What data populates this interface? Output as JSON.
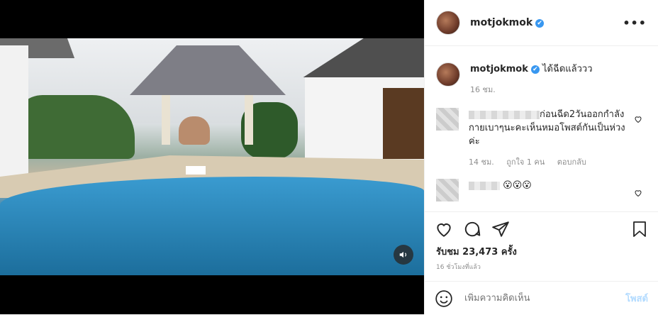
{
  "header": {
    "username": "motjokmok",
    "verified_icon": "✔",
    "more_icon": "more-horizontal-icon"
  },
  "caption": {
    "username": "motjokmok",
    "text": "ได้ฉีดแล้ววว",
    "time": "16 ชม."
  },
  "comments": [
    {
      "text": "ก่อนฉีด2วันออกกำลังกายเบาๆนะคะเห็นหมอโพสต์กันเป็นห่วงค่ะ",
      "time": "14 ชม.",
      "likes": "ถูกใจ 1 คน",
      "reply": "ตอบกลับ"
    },
    {
      "text": "😮😮😮"
    }
  ],
  "stats": {
    "views": "รับชม 23,473 ครั้ง",
    "posted": "16 ชั่วโมงที่แล้ว"
  },
  "composer": {
    "placeholder": "เพิ่มความคิดเห็น",
    "post_label": "โพสต์"
  },
  "colors": {
    "verified": "#3897f0",
    "post_disabled": "#b3dbff",
    "muted": "#8e8e8e"
  }
}
